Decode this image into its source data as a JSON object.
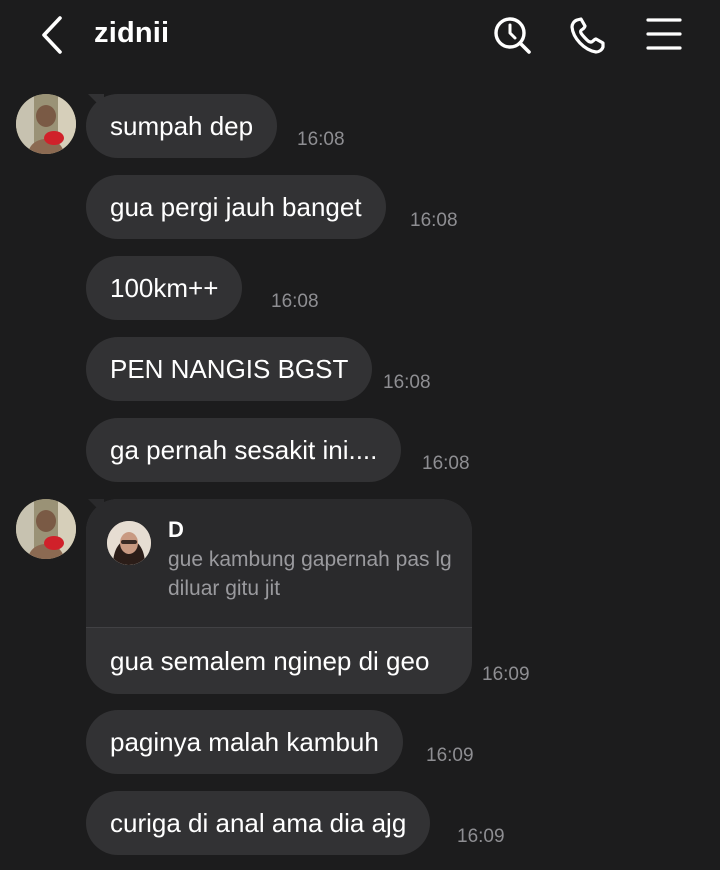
{
  "header": {
    "contact_name": "zidnii",
    "back_icon": "chevron-left-icon",
    "search_icon": "search-icon",
    "call_icon": "phone-icon",
    "menu_icon": "hamburger-menu-icon"
  },
  "messages": [
    {
      "text": "sumpah dep",
      "time": "16:08"
    },
    {
      "text": "gua pergi jauh banget",
      "time": "16:08"
    },
    {
      "text": "100km++",
      "time": "16:08"
    },
    {
      "text": "PEN NANGIS BGST",
      "time": "16:08"
    },
    {
      "text": "ga pernah sesakit ini....",
      "time": "16:08"
    },
    {
      "reply_to": {
        "name": "D",
        "text": "gue kambung gapernah pas lg diluar gitu jit"
      },
      "text": "gua semalem nginep di geo",
      "time": "16:09"
    },
    {
      "text": "paginya malah kambuh",
      "time": "16:09"
    },
    {
      "text": "curiga di anal ama dia ajg",
      "time": "16:09"
    }
  ],
  "colors": {
    "background": "#1c1c1d",
    "bubble": "#323234",
    "timestamp": "#8e8e92"
  }
}
